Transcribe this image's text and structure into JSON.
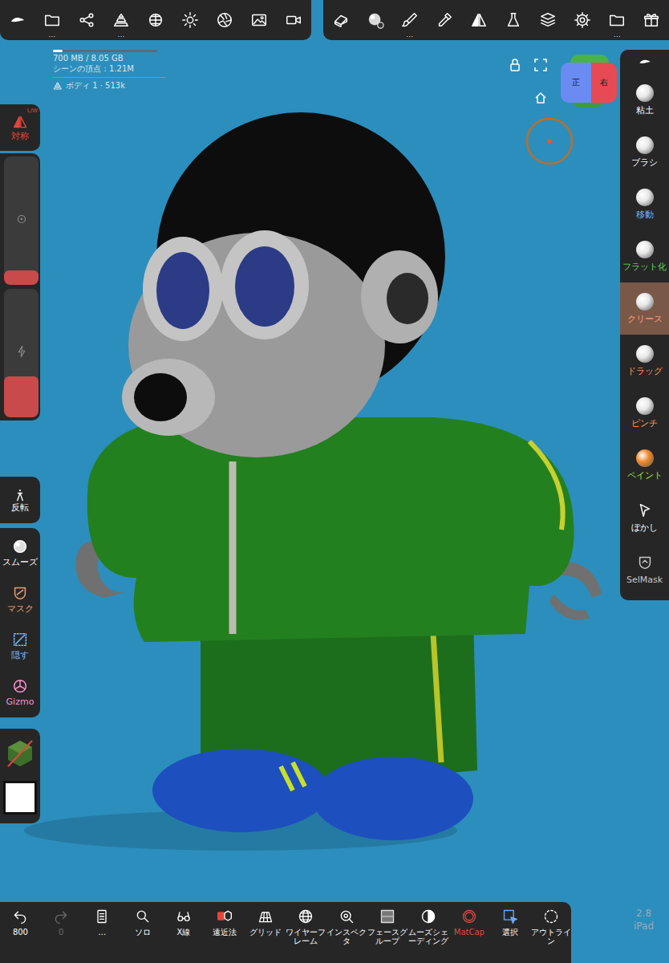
{
  "top_bar": {
    "left": [
      {
        "more": ""
      },
      {
        "more": "…"
      },
      {
        "more": ""
      },
      {
        "more": "…"
      },
      {
        "more": ""
      },
      {
        "more": ""
      },
      {
        "more": ""
      },
      {
        "more": ""
      },
      {
        "more": ""
      }
    ],
    "right": [
      {
        "more": ""
      },
      {
        "more": ""
      },
      {
        "more": "…"
      },
      {
        "more": ""
      },
      {
        "more": ""
      },
      {
        "more": ""
      },
      {
        "more": ""
      },
      {
        "more": ""
      },
      {
        "more": "…"
      },
      {
        "more": ""
      }
    ]
  },
  "info": {
    "memory": "700 MB / 8.05 GB",
    "memory_level": 0.09,
    "vertices": "シーンの頂点：1.21M",
    "mesh": "ボディ 1 · 513k"
  },
  "view": {
    "cube_front": "正",
    "cube_right": "右"
  },
  "left_panel": {
    "symmetry": {
      "label": "対称",
      "badge": "L/W",
      "on": true
    },
    "sliders": [
      {
        "level": 0.11
      },
      {
        "level": 0.32
      }
    ],
    "invert": {
      "label": "反転"
    },
    "tools": [
      {
        "label": "スムーズ",
        "color": "#ffffff"
      },
      {
        "label": "マスク",
        "color": "#e9a070"
      },
      {
        "label": "隠す",
        "color": "#7ab8ff"
      },
      {
        "label": "Gizmo",
        "color": "#ff8fd0"
      }
    ],
    "paint_color": "#ffffff"
  },
  "tools": [
    {
      "label": "粘土",
      "selected": false,
      "color": "#ffffff"
    },
    {
      "label": "ブラシ",
      "selected": false,
      "color": "#ffffff"
    },
    {
      "label": "移動",
      "selected": false,
      "color": "#7ab8ff"
    },
    {
      "label": "フラット化",
      "selected": false,
      "color": "#5fd35f"
    },
    {
      "label": "クリース",
      "selected": true,
      "color": "#ff9f74"
    },
    {
      "label": "ドラッグ",
      "selected": false,
      "color": "#ff9a5a"
    },
    {
      "label": "ピンチ",
      "selected": false,
      "color": "#ff9a5a"
    },
    {
      "label": "ペイント",
      "selected": false,
      "color": "#9fe23a"
    },
    {
      "label": "ぼかし",
      "selected": false,
      "color": "#ffffff"
    },
    {
      "label": "SelMask",
      "selected": false,
      "color": "#c8c8c8"
    }
  ],
  "bottom_bar": [
    {
      "label": "800",
      "selected": false,
      "disabled": false,
      "color": "#ffffff"
    },
    {
      "label": "0",
      "selected": false,
      "disabled": true,
      "color": "#6a6a6a"
    },
    {
      "label": "…",
      "selected": false,
      "disabled": false,
      "color": "#ffffff"
    },
    {
      "label": "ソロ",
      "selected": false,
      "disabled": false,
      "color": "#ffffff"
    },
    {
      "label": "X線",
      "selected": false,
      "disabled": false,
      "color": "#ffffff"
    },
    {
      "label": "遠近法",
      "selected": true,
      "disabled": false,
      "color": "#e0463c"
    },
    {
      "label": "グリッド",
      "selected": false,
      "disabled": false,
      "color": "#ffffff"
    },
    {
      "label": "ワイヤーフレーム",
      "selected": false,
      "disabled": false,
      "color": "#ffffff"
    },
    {
      "label": "インスペクタ",
      "selected": false,
      "disabled": false,
      "color": "#ffffff"
    },
    {
      "label": "フェースグループ",
      "selected": false,
      "disabled": false,
      "color": "#ffffff"
    },
    {
      "label": "ムーズシェーディング",
      "selected": false,
      "disabled": false,
      "color": "#ffffff"
    },
    {
      "label": "MatCap",
      "selected": true,
      "disabled": false,
      "color": "#e0463c"
    },
    {
      "label": "選択",
      "selected": false,
      "disabled": false,
      "color": "#6aa8ff"
    },
    {
      "label": "アウトライン",
      "selected": false,
      "disabled": false,
      "color": "#ffffff"
    }
  ],
  "version": "2.8",
  "device": "iPad"
}
